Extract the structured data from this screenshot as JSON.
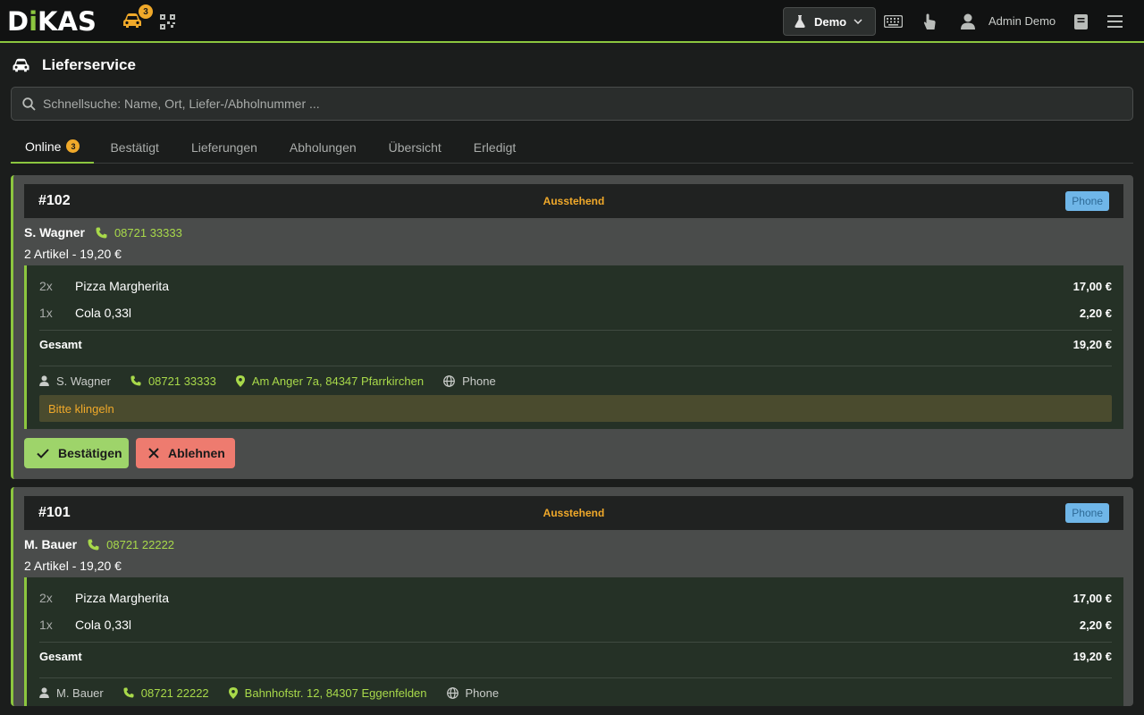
{
  "app": {
    "logo": "DIKAS",
    "car_badge": "3"
  },
  "header": {
    "demo_label": "Demo",
    "user_name": "Admin Demo"
  },
  "page": {
    "title": "Lieferservice"
  },
  "search": {
    "placeholder": "Schnellsuche: Name, Ort, Liefer-/Abholnummer ..."
  },
  "tabs": [
    {
      "label": "Online",
      "count": "3"
    },
    {
      "label": "Bestätigt"
    },
    {
      "label": "Lieferungen"
    },
    {
      "label": "Abholungen"
    },
    {
      "label": "Übersicht"
    },
    {
      "label": "Erledigt"
    }
  ],
  "orders": [
    {
      "number": "#102",
      "status": "Ausstehend",
      "source": "Phone",
      "customer": "S. Wagner",
      "phone": "08721 33333",
      "summary": "2 Artikel - 19,20 €",
      "items": [
        {
          "qty": "2x",
          "name": "Pizza Margherita",
          "price": "17,00 €"
        },
        {
          "qty": "1x",
          "name": "Cola 0,33l",
          "price": "2,20 €"
        }
      ],
      "total_label": "Gesamt",
      "total": "19,20 €",
      "address": "Am Anger 7a, 84347 Pfarrkirchen",
      "note": "Bitte klingeln",
      "confirm_label": "Bestätigen",
      "reject_label": "Ablehnen"
    },
    {
      "number": "#101",
      "status": "Ausstehend",
      "source": "Phone",
      "customer": "M. Bauer",
      "phone": "08721 22222",
      "summary": "2 Artikel - 19,20 €",
      "items": [
        {
          "qty": "2x",
          "name": "Pizza Margherita",
          "price": "17,00 €"
        },
        {
          "qty": "1x",
          "name": "Cola 0,33l",
          "price": "2,20 €"
        }
      ],
      "total_label": "Gesamt",
      "total": "19,20 €",
      "address": "Bahnhofstr. 12, 84307 Eggenfelden"
    }
  ],
  "colors": {
    "accent": "#8cc63f",
    "warning": "#f0a92a",
    "confirm": "#9ed46a",
    "reject": "#ee7b6f",
    "badge_blue": "#6fb6e8"
  }
}
